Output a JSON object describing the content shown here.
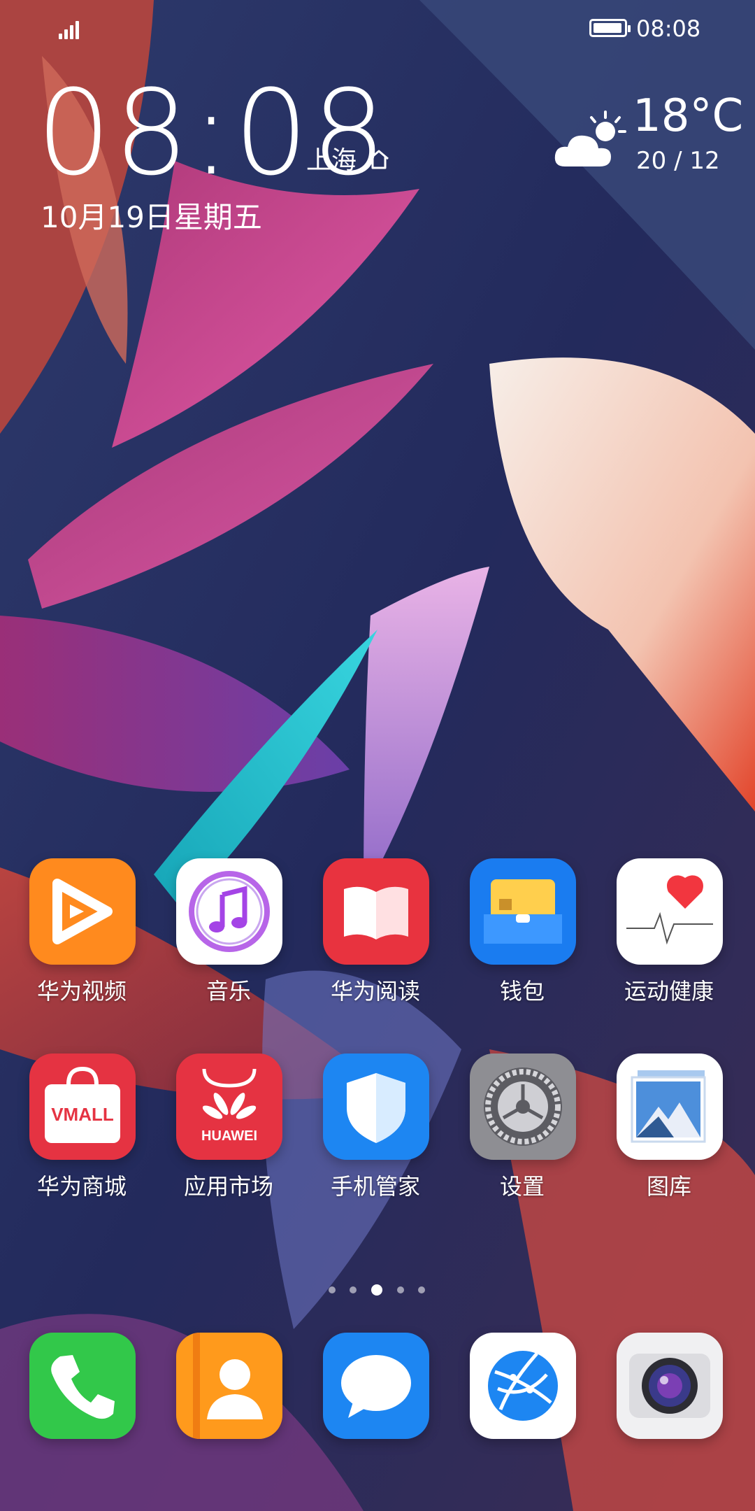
{
  "status_bar": {
    "time": "08:08",
    "battery_level": 0.95
  },
  "clock_widget": {
    "time": "08:08",
    "city": "上海",
    "date": "10月19日星期五"
  },
  "weather": {
    "temperature": "18°C",
    "range": "20 / 12",
    "condition_icon": "partly-cloudy-icon"
  },
  "apps_row1": [
    {
      "label": "华为视频",
      "icon": "video-play-icon"
    },
    {
      "label": "音乐",
      "icon": "music-note-icon"
    },
    {
      "label": "华为阅读",
      "icon": "book-icon"
    },
    {
      "label": "钱包",
      "icon": "wallet-icon"
    },
    {
      "label": "运动健康",
      "icon": "heart-pulse-icon"
    }
  ],
  "apps_row2": [
    {
      "label": "华为商城",
      "icon": "shopping-bag-icon",
      "icon_text": "VMALL"
    },
    {
      "label": "应用市场",
      "icon": "app-store-icon",
      "icon_text": "HUAWEI"
    },
    {
      "label": "手机管家",
      "icon": "shield-icon"
    },
    {
      "label": "设置",
      "icon": "gear-icon"
    },
    {
      "label": "图库",
      "icon": "gallery-icon"
    }
  ],
  "page_indicator": {
    "pages": 5,
    "current": 3
  },
  "dock": [
    {
      "icon": "phone-icon"
    },
    {
      "icon": "contacts-icon"
    },
    {
      "icon": "message-icon"
    },
    {
      "icon": "browser-icon"
    },
    {
      "icon": "camera-icon"
    }
  ],
  "colors": {
    "video": "#ff8a1e",
    "reading": "#e8333f",
    "wallet": "#1a7cf0",
    "vmall": "#e53342",
    "appmarket": "#e53342",
    "manager": "#1d86f2",
    "settings": "#8e8e93",
    "phone": "#32c84a",
    "contacts": "#ff9a1c",
    "messages": "#1d86f2"
  }
}
